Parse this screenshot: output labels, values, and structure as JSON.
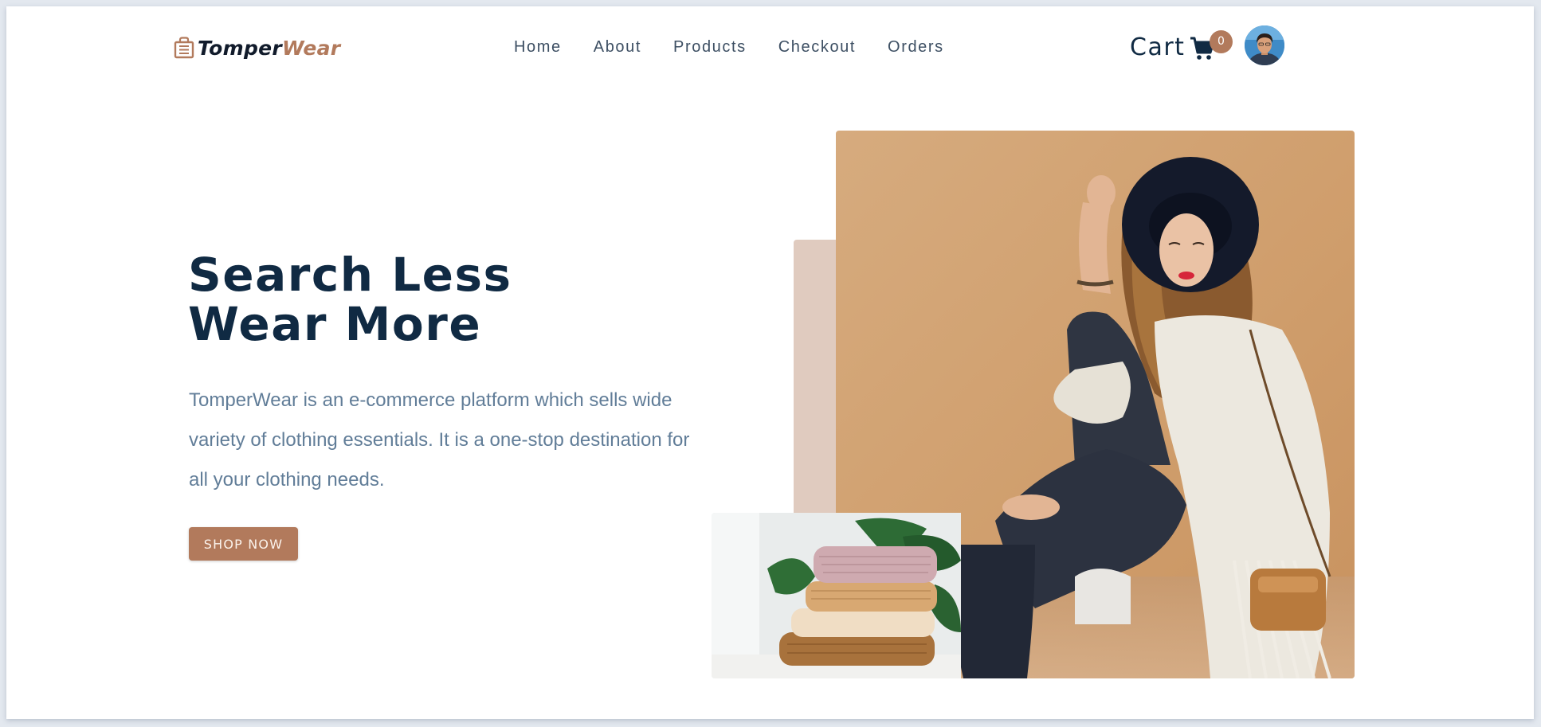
{
  "brand": {
    "name_part1": "Tomper",
    "name_part2": "Wear",
    "colors": {
      "primary_dark": "#102a43",
      "accent": "#b27a5c",
      "muted_text": "#617d98"
    }
  },
  "nav": {
    "links": [
      "Home",
      "About",
      "Products",
      "Checkout",
      "Orders"
    ]
  },
  "cart": {
    "label": "Cart",
    "count": "0",
    "icon": "shopping-cart-icon"
  },
  "user": {
    "avatar_icon": "user-avatar"
  },
  "hero": {
    "title_line1": "Search Less",
    "title_line2": "Wear More",
    "description": "TomperWear is an e-commerce platform which sells wide variety of clothing essentials. It is a one-stop destination for all your clothing needs.",
    "cta_label": "SHOP NOW",
    "main_image": "woman-in-hat-photo",
    "secondary_image": "folded-sweaters-photo"
  }
}
